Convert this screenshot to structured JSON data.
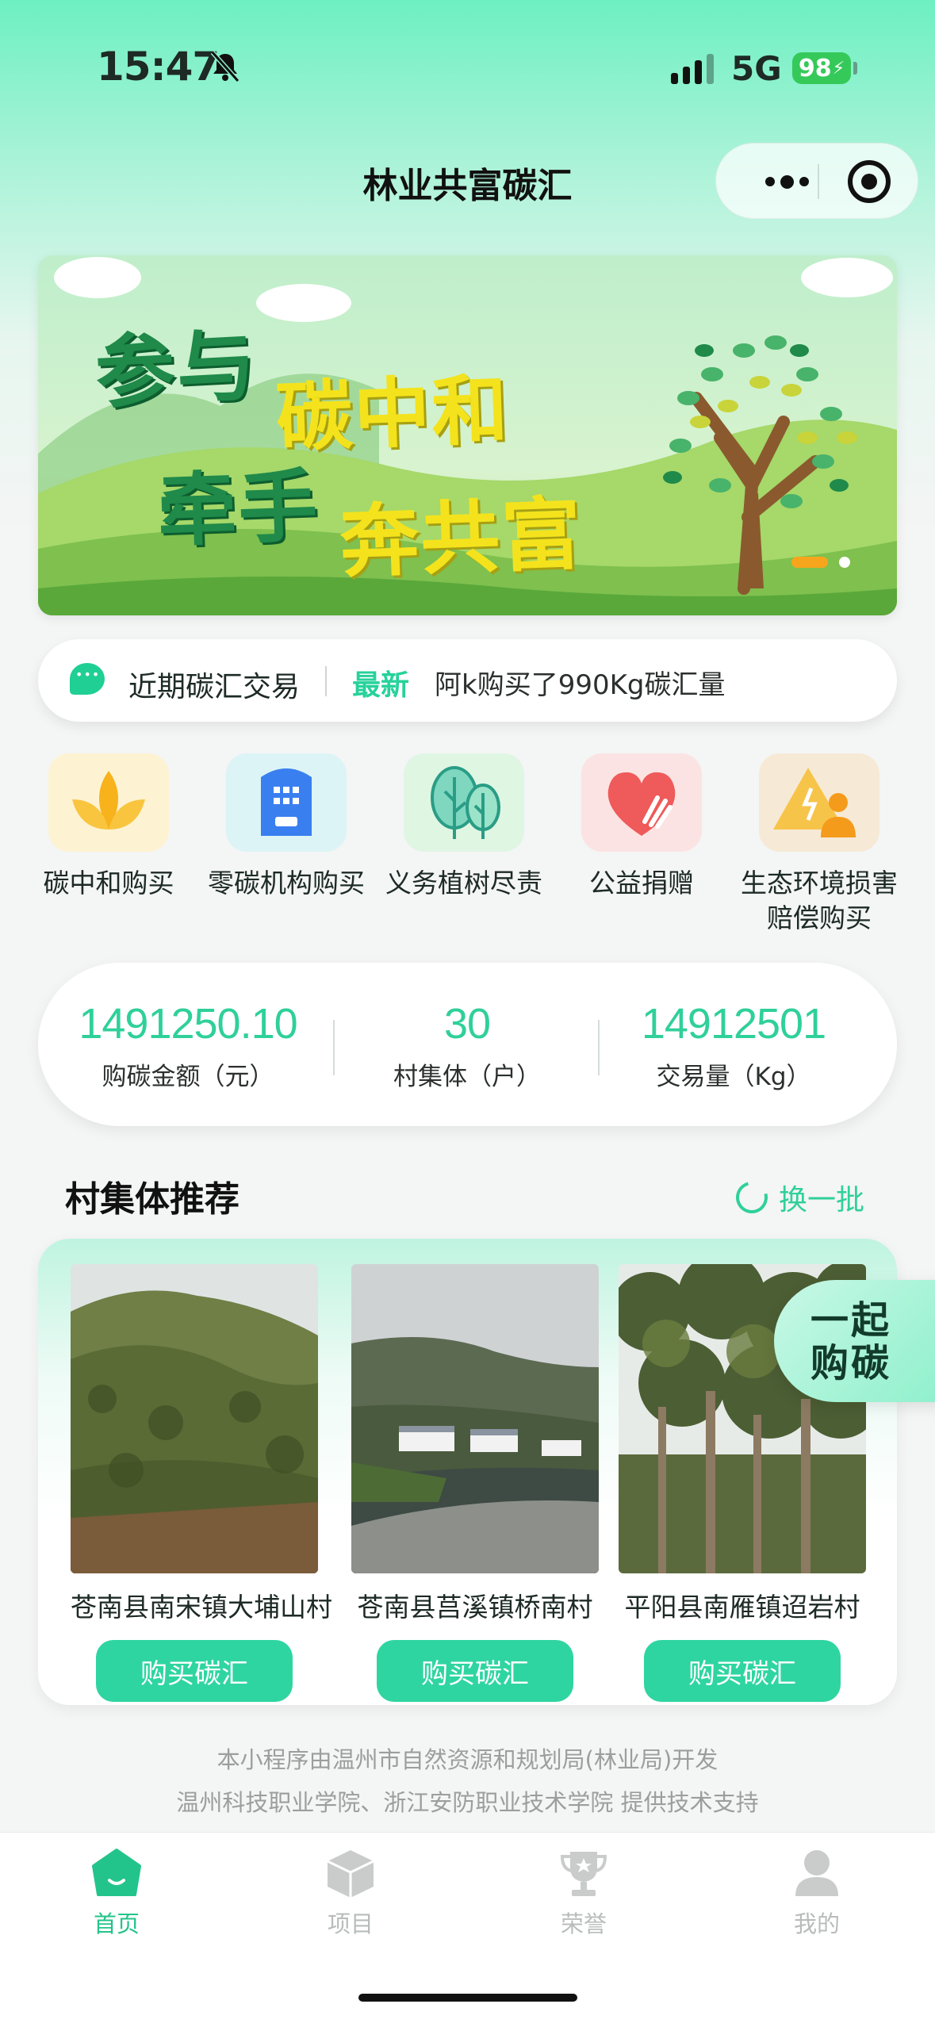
{
  "status_bar": {
    "time": "15:47",
    "network": "5G",
    "battery": "98"
  },
  "header": {
    "title": "林业共富碳汇"
  },
  "banner": {
    "line1_a": "参与",
    "line1_b": "碳中和",
    "line2_a": "牵手",
    "line2_b": "奔共富"
  },
  "notice": {
    "title": "近期碳汇交易",
    "tag": "最新",
    "message": "阿k购买了990Kg碳汇量"
  },
  "categories": [
    {
      "label": "碳中和购买",
      "icon": "leaf-icon"
    },
    {
      "label": "零碳机构购买",
      "icon": "building-icon"
    },
    {
      "label": "义务植树尽责",
      "icon": "trees-icon"
    },
    {
      "label": "公益捐赠",
      "icon": "heart-hands-icon"
    },
    {
      "label": "生态环境损害赔偿购买",
      "icon": "warning-person-icon"
    }
  ],
  "stats": [
    {
      "value": "1491250.10",
      "label": "购碳金额（元）"
    },
    {
      "value": "30",
      "label": "村集体（户）"
    },
    {
      "value": "14912501",
      "label": "交易量（Kg）"
    }
  ],
  "villages_section": {
    "title": "村集体推荐",
    "refresh_label": "换一批",
    "items": [
      {
        "name": "苍南县南宋镇大埔山村",
        "button": "购买碳汇"
      },
      {
        "name": "苍南县莒溪镇桥南村",
        "button": "购买碳汇"
      },
      {
        "name": "平阳县南雁镇迢岩村",
        "button": "购买碳汇"
      }
    ]
  },
  "float_button": {
    "line1": "一起",
    "line2": "购碳"
  },
  "footer": {
    "line1": "本小程序由温州市自然资源和规划局(林业局)开发",
    "line2": "温州科技职业学院、浙江安防职业技术学院 提供技术支持"
  },
  "tabbar": [
    {
      "label": "首页",
      "active": true
    },
    {
      "label": "项目",
      "active": false
    },
    {
      "label": "荣誉",
      "active": false
    },
    {
      "label": "我的",
      "active": false
    }
  ],
  "colors": {
    "accent": "#2fd5a1",
    "accent_text": "#2fd09a",
    "highlight": "#f7a51c"
  }
}
